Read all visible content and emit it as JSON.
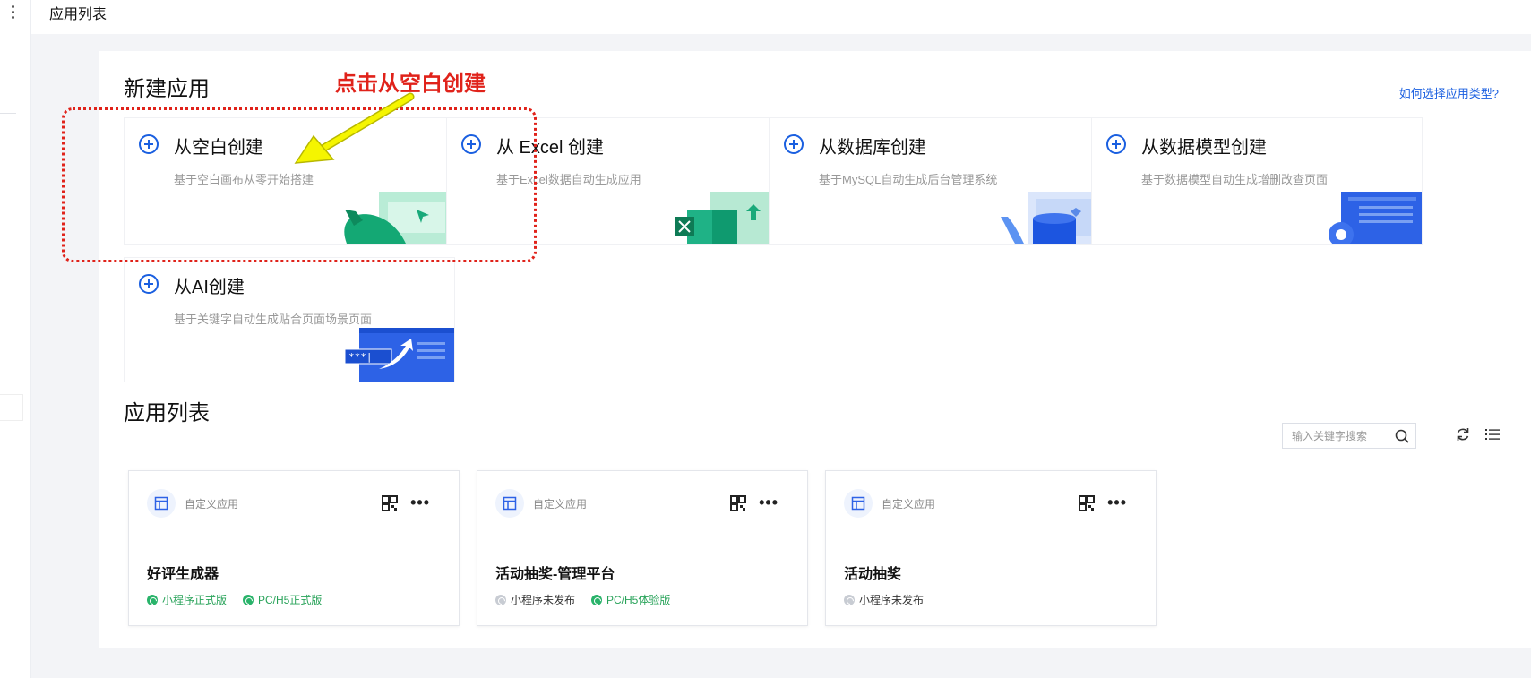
{
  "header": {
    "title": "应用列表"
  },
  "new_app": {
    "title": "新建应用",
    "help_link": "如何选择应用类型?",
    "cards": [
      {
        "title": "从空白创建",
        "desc": "基于空白画布从零开始搭建",
        "icon": "plus-circle-icon"
      },
      {
        "title": "从 Excel 创建",
        "desc": "基于Excel数据自动生成应用",
        "icon": "plus-circle-icon"
      },
      {
        "title": "从数据库创建",
        "desc": "基于MySQL自动生成后台管理系统",
        "icon": "plus-circle-icon"
      },
      {
        "title": "从数据模型创建",
        "desc": "基于数据模型自动生成增删改查页面",
        "icon": "plus-circle-icon"
      },
      {
        "title": "从AI创建",
        "desc": "基于关键字自动生成贴合页面场景页面",
        "icon": "plus-circle-icon"
      }
    ]
  },
  "annotation": {
    "label": "点击从空白创建",
    "color": "#e0221a",
    "arrow_color": "#f5f500"
  },
  "app_list": {
    "title": "应用列表",
    "search_placeholder": "输入关键字搜索",
    "apps": [
      {
        "type": "自定义应用",
        "name": "好评生成器",
        "badges": [
          {
            "label": "小程序正式版",
            "status": "published"
          },
          {
            "label": "PC/H5正式版",
            "status": "published"
          }
        ]
      },
      {
        "type": "自定义应用",
        "name": "活动抽奖-管理平台",
        "badges": [
          {
            "label": "小程序未发布",
            "status": "unpublished"
          },
          {
            "label": "PC/H5体验版",
            "status": "published"
          }
        ]
      },
      {
        "type": "自定义应用",
        "name": "活动抽奖",
        "badges": [
          {
            "label": "小程序未发布",
            "status": "unpublished"
          }
        ]
      }
    ]
  },
  "colors": {
    "accent": "#1a5fe0",
    "published": "#29a35a",
    "unpublished": "#c8ccd3",
    "page_bg": "#f3f4f7"
  }
}
